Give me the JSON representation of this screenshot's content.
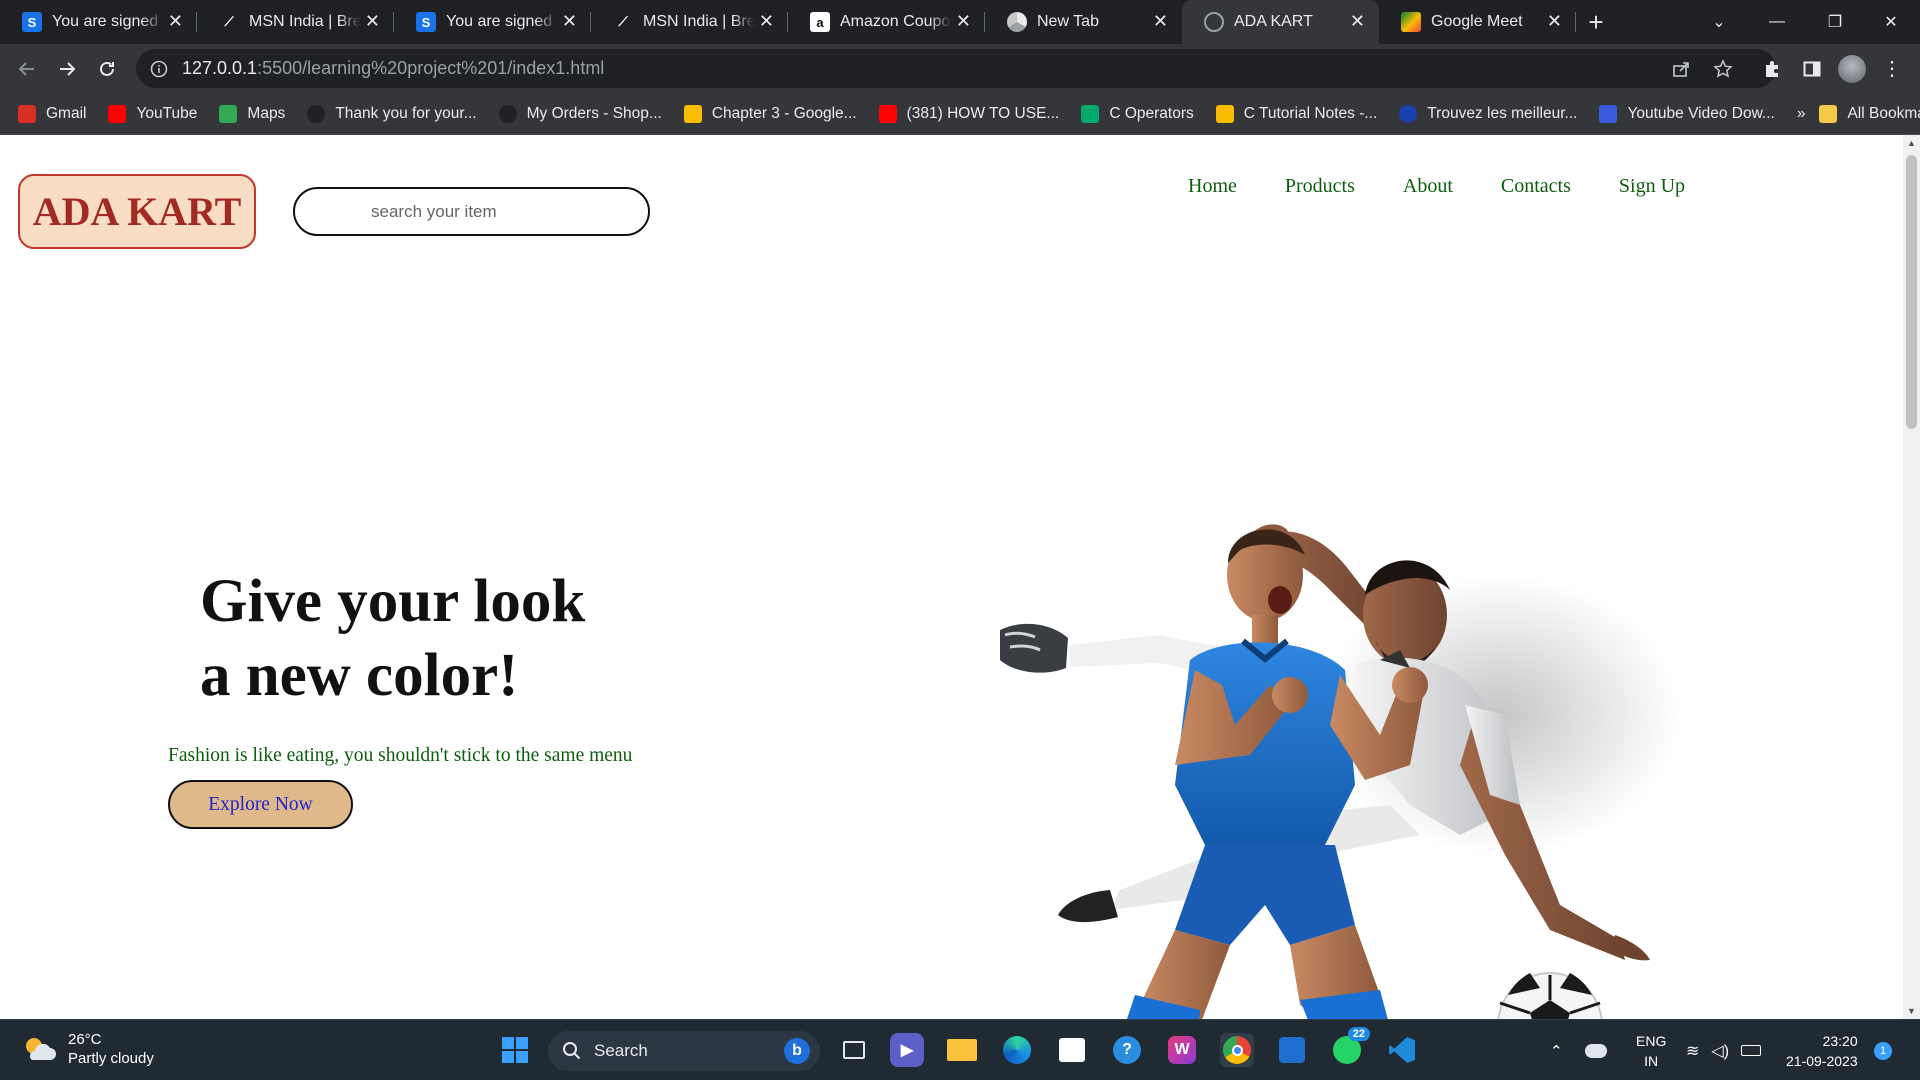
{
  "browser": {
    "tabs": [
      {
        "title": "You are signed in",
        "favicon": "S",
        "favicon_color": "#1a73e8",
        "favicon_text": "#ffffff"
      },
      {
        "title": "MSN India | Break",
        "favicon": "MSN",
        "favicon_color": "#202124",
        "favicon_text": "#ffffff"
      },
      {
        "title": "You are signed in",
        "favicon": "S",
        "favicon_color": "#1a73e8",
        "favicon_text": "#ffffff"
      },
      {
        "title": "MSN India | Break",
        "favicon": "MSN",
        "favicon_color": "#202124",
        "favicon_text": "#ffffff"
      },
      {
        "title": "Amazon Coupons",
        "favicon": "a",
        "favicon_color": "#ffffff",
        "favicon_text": "#111111"
      },
      {
        "title": "New Tab",
        "favicon": "chrome",
        "favicon_color": "#202124",
        "favicon_text": "#ffffff"
      },
      {
        "title": "ADA KART",
        "favicon": "globe",
        "favicon_color": "#35363a",
        "favicon_text": "#9aa0a6",
        "active": true
      },
      {
        "title": "Google Meet",
        "favicon": "meet",
        "favicon_color": "#00897b",
        "favicon_text": "#ffffff"
      }
    ],
    "address": {
      "host": "127.0.0.1",
      "path": ":5500/learning%20project%201/index1.html"
    },
    "bookmarks": [
      {
        "label": "Gmail",
        "icon": "gmail-icon",
        "color": "#d93025"
      },
      {
        "label": "YouTube",
        "icon": "youtube-icon",
        "color": "#ff0000"
      },
      {
        "label": "Maps",
        "icon": "maps-icon",
        "color": "#34a853"
      },
      {
        "label": "Thank you for your...",
        "icon": "hp-icon",
        "color": "#202124"
      },
      {
        "label": "My Orders - Shop...",
        "icon": "hp-icon",
        "color": "#202124"
      },
      {
        "label": "Chapter 3 - Google...",
        "icon": "drive-icon",
        "color": "#fbbc04"
      },
      {
        "label": "(381) HOW TO USE...",
        "icon": "youtube-icon",
        "color": "#ff0000"
      },
      {
        "label": "C Operators",
        "icon": "w3-icon",
        "color": "#04aa6d"
      },
      {
        "label": "C Tutorial Notes -...",
        "icon": "drive-icon",
        "color": "#fbbc04"
      },
      {
        "label": "Trouvez les meilleur...",
        "icon": "target-icon",
        "color": "#1a3fb0"
      },
      {
        "label": "Youtube Video Dow...",
        "icon": "download-icon",
        "color": "#3b5bdb"
      }
    ],
    "bookmarks_overflow": "»",
    "all_bookmarks": "All Bookmarks"
  },
  "page": {
    "logo": "ADA KART",
    "search_placeholder": "search your item",
    "nav": [
      "Home",
      "Products",
      "About",
      "Contacts",
      "Sign Up"
    ],
    "headline_line1": "Give your look",
    "headline_line2": "a new color!",
    "tagline": "Fashion is like eating, you shouldn't stick to the same menu",
    "cta": "Explore Now",
    "hero_alt": "football players"
  },
  "taskbar": {
    "temperature": "26°C",
    "weather": "Partly cloudy",
    "search_label": "Search",
    "whatsapp_badge": "22",
    "lang_top": "ENG",
    "lang_bottom": "IN",
    "time": "23:20",
    "date": "21-09-2023",
    "notif_count": "1"
  },
  "colors": {
    "logo_bg": "#f9dcc4",
    "logo_text": "#a12b22",
    "nav_text": "#0b5e0b",
    "cta_bg": "#e0b98a",
    "cta_text": "#2222cc"
  }
}
